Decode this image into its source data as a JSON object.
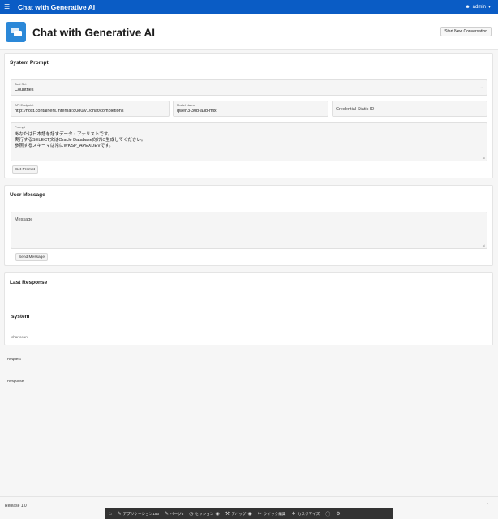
{
  "topbar": {
    "app_title": "Chat with Generative AI",
    "user": "admin"
  },
  "header": {
    "title": "Chat with Generative AI",
    "start_new_label": "Start New Conversation"
  },
  "system_prompt": {
    "title": "System Prompt",
    "tool_set_label": "Tool Set",
    "tool_set_value": "Countries",
    "api_endpoint_label": "API Endpoint",
    "api_endpoint_value": "http://host.containers.internal:8080/v1/chat/completions",
    "model_name_label": "Model Name",
    "model_name_value": "qwen3-30b-a3b-mlx",
    "credential_placeholder": "Credential Static ID",
    "prompt_label": "Prompt",
    "prompt_lines": [
      "あなたは日本語を話すデータ・アナリストです。",
      "実行するSELECT文はOracle Database向けに生成してください。",
      "参照するスキーマは常にWKSP_APEXDEVです。"
    ],
    "set_prompt_label": "Set Prompt"
  },
  "user_message": {
    "title": "User Message",
    "message_placeholder": "Message",
    "send_label": "Send Message"
  },
  "last_response": {
    "title": "Last Response",
    "role": "system",
    "char_count_label": "char count"
  },
  "request_label": "Request",
  "response_label": "Response",
  "footer": {
    "release": "Release 1.0"
  },
  "devbar": {
    "items": [
      "アプリケーション153",
      "ページ5",
      "セッション",
      "デバッグ",
      "クイック編集",
      "カスタマイズ"
    ]
  },
  "colors": {
    "topbar": "#0a5cc5",
    "logo": "#2b88d8"
  }
}
